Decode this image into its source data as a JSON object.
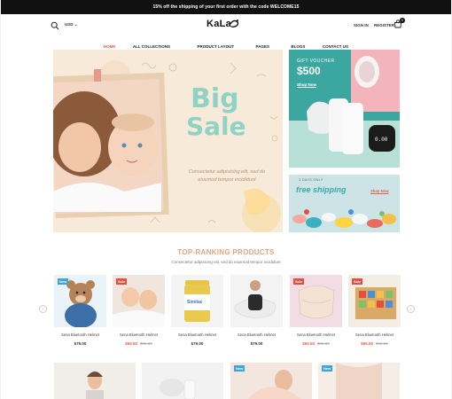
{
  "announcement": "15% off the shipping of your first order with the code WELCOME15",
  "header": {
    "currency": "USD",
    "logo": "KaLa",
    "sign_in": "SIGN IN",
    "register": "REGISTER",
    "cart_count": "0"
  },
  "nav": {
    "items": [
      {
        "label": "HOME",
        "active": true
      },
      {
        "label": "ALL COLLECTIONS"
      },
      {
        "label": "PRODUCT LAYOUT"
      },
      {
        "label": "PAGES"
      },
      {
        "label": "BLOGS"
      },
      {
        "label": "CONTACT US"
      }
    ]
  },
  "hero": {
    "title_line1": "Big",
    "title_line2": "Sale",
    "description": "Consectetur adipisicing elit, sed do eiusmod tempor incididunt"
  },
  "promo_gift": {
    "label": "GIFT VOUCHER",
    "amount": "$500",
    "link": "Shop Now",
    "display_text": "0.00"
  },
  "promo_shipping": {
    "small": "3 DAYS ONLY",
    "big": "free shipping",
    "link": "Shop Now"
  },
  "section": {
    "title": "TOP-RANKING PRODUCTS",
    "subtitle": "Consectetur adipisicing elit, sed do eiusmod tempor incididunt"
  },
  "products": [
    {
      "name": "Sena Bluetooth Helmet",
      "price": "$79.00",
      "old_price": "",
      "badge": "New"
    },
    {
      "name": "Sena Bluetooth Helmet",
      "price": "$65.50",
      "old_price": "$95.00",
      "badge": "Sale"
    },
    {
      "name": "Sena Bluetooth Helmet",
      "price": "$79.00",
      "old_price": "",
      "badge": ""
    },
    {
      "name": "Sena Bluetooth Helmet",
      "price": "$79.00",
      "old_price": "",
      "badge": ""
    },
    {
      "name": "Sena Bluetooth Helmet",
      "price": "$65.50",
      "old_price": "$95.00",
      "badge": "Sale"
    },
    {
      "name": "Sena Bluetooth Helmet",
      "price": "$65.50",
      "old_price": "$95.00",
      "badge": "Sale"
    }
  ],
  "bottom_badges": [
    "New",
    "New"
  ],
  "colors": {
    "accent": "#e85d4a",
    "teal": "#3ba7a0",
    "section_title": "#e0a47c"
  }
}
